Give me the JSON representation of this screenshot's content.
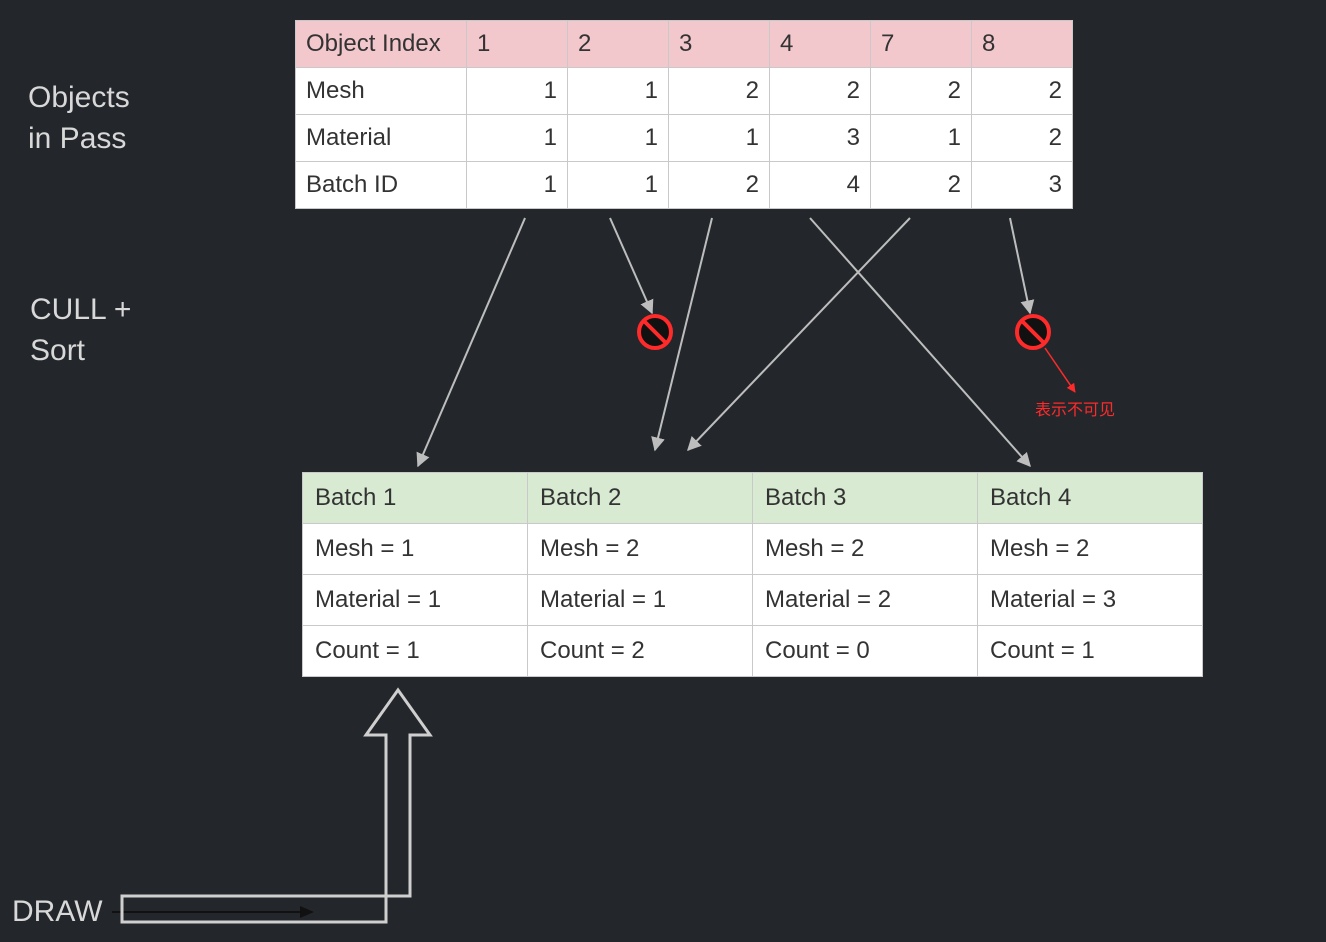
{
  "labels": {
    "objects_in_pass": "Objects\nin Pass",
    "cull_sort": "CULL +\nSort",
    "draw": "DRAW",
    "annotation_invisible": "表示不可见"
  },
  "top_table": {
    "header_label": "Object Index",
    "columns": [
      "1",
      "2",
      "3",
      "4",
      "7",
      "8"
    ],
    "rows": [
      {
        "label": "Mesh",
        "values": [
          "1",
          "1",
          "2",
          "2",
          "2",
          "2"
        ]
      },
      {
        "label": "Material",
        "values": [
          "1",
          "1",
          "1",
          "3",
          "1",
          "2"
        ]
      },
      {
        "label": "Batch ID",
        "values": [
          "1",
          "1",
          "2",
          "4",
          "2",
          "3"
        ]
      }
    ]
  },
  "bottom_table": {
    "headers": [
      "Batch 1",
      "Batch 2",
      "Batch 3",
      "Batch 4"
    ],
    "rows": [
      [
        "Mesh = 1",
        "Mesh = 2",
        "Mesh = 2",
        "Mesh = 2"
      ],
      [
        "Material = 1",
        "Material = 1",
        "Material = 2",
        "Material = 3"
      ],
      [
        "Count = 1",
        "Count = 2",
        "Count = 0",
        "Count = 1"
      ]
    ]
  },
  "chart_data": {
    "type": "table",
    "title": "Objects in Pass → CULL + Sort → DRAW batching diagram",
    "objects_in_pass": [
      {
        "object_index": 1,
        "mesh": 1,
        "material": 1,
        "batch_id": 1
      },
      {
        "object_index": 2,
        "mesh": 1,
        "material": 1,
        "batch_id": 1
      },
      {
        "object_index": 3,
        "mesh": 2,
        "material": 1,
        "batch_id": 2
      },
      {
        "object_index": 4,
        "mesh": 2,
        "material": 3,
        "batch_id": 4
      },
      {
        "object_index": 7,
        "mesh": 2,
        "material": 1,
        "batch_id": 2
      },
      {
        "object_index": 8,
        "mesh": 2,
        "material": 2,
        "batch_id": 3
      }
    ],
    "culled_object_indices": [
      2,
      8
    ],
    "culled_annotation": "表示不可见",
    "batches_after_sort": [
      {
        "batch": 1,
        "mesh": 1,
        "material": 1,
        "count": 1
      },
      {
        "batch": 2,
        "mesh": 2,
        "material": 1,
        "count": 2
      },
      {
        "batch": 3,
        "mesh": 2,
        "material": 2,
        "count": 0
      },
      {
        "batch": 4,
        "mesh": 2,
        "material": 3,
        "count": 1
      }
    ],
    "arrows": [
      {
        "from_object_index": 1,
        "to": "Batch 1"
      },
      {
        "from_object_index": 2,
        "to": "culled"
      },
      {
        "from_object_index": 3,
        "to": "Batch 2"
      },
      {
        "from_object_index": 4,
        "to": "Batch 4"
      },
      {
        "from_object_index": 7,
        "to": "Batch 2"
      },
      {
        "from_object_index": 8,
        "to": "culled"
      }
    ],
    "draw_flow": "DRAW → Batch 1"
  }
}
